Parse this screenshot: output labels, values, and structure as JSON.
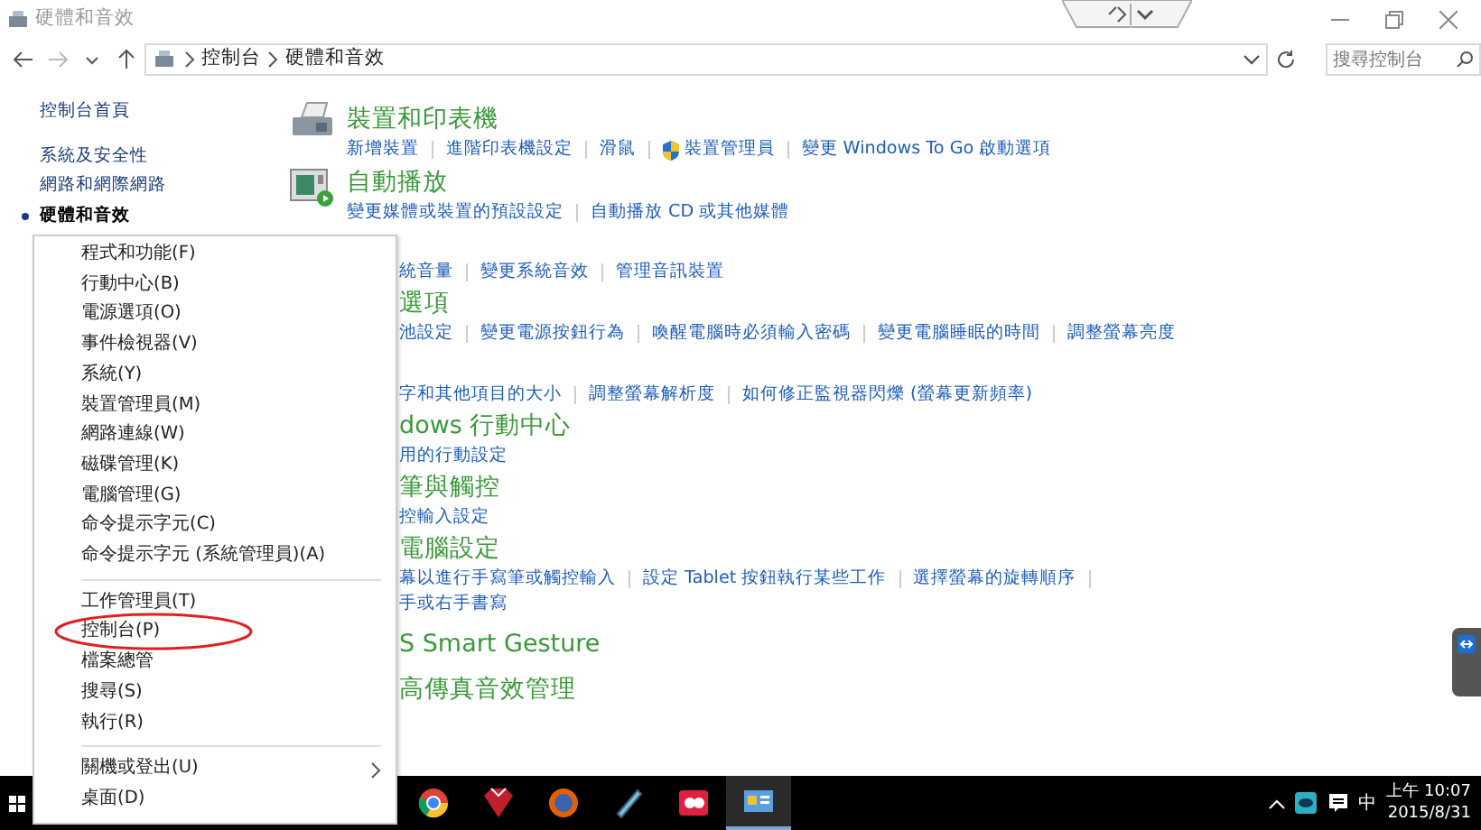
{
  "window": {
    "title": "硬體和音效"
  },
  "address_bar": {
    "breadcrumbs": [
      "控制台",
      "硬體和音效"
    ],
    "search_placeholder": "搜尋控制台"
  },
  "sidebar": {
    "items": [
      {
        "label": "控制台首頁",
        "kind": "home",
        "selected": false
      },
      {
        "label": "系統及安全性",
        "kind": "category",
        "selected": false
      },
      {
        "label": "網路和網際網路",
        "kind": "category",
        "selected": false
      },
      {
        "label": "硬體和音效",
        "kind": "category",
        "selected": true
      }
    ]
  },
  "sections": [
    {
      "title": "裝置和印表機",
      "links": [
        {
          "label": "新增裝置",
          "shield": false
        },
        {
          "label": "進階印表機設定",
          "shield": false
        },
        {
          "label": "滑鼠",
          "shield": false
        },
        {
          "label": "裝置管理員",
          "shield": true
        },
        {
          "label": "變更 Windows To Go 啟動選項",
          "shield": false
        }
      ]
    },
    {
      "title": "自動播放",
      "links": [
        {
          "label": "變更媒體或裝置的預設設定",
          "shield": false
        },
        {
          "label": "自動播放 CD 或其他媒體",
          "shield": false
        }
      ]
    }
  ],
  "sections_behind_menu": [
    {
      "link_rows": [
        {
          "links": [
            "統音量",
            "變更系統音效",
            "管理音訊裝置"
          ],
          "trailing_separator": false
        }
      ]
    },
    {
      "title": "選項",
      "link_rows": [
        {
          "links": [
            "池設定",
            "變更電源按鈕行為",
            "喚醒電腦時必須輸入密碼",
            "變更電腦睡眠的時間",
            "調整螢幕亮度"
          ],
          "trailing_separator": false
        }
      ]
    },
    {
      "link_rows": [
        {
          "links": [
            "字和其他項目的大小",
            "調整螢幕解析度",
            "如何修正監視器閃爍 (螢幕更新頻率)"
          ],
          "trailing_separator": false
        }
      ]
    },
    {
      "title": "dows 行動中心",
      "link_rows": [
        {
          "links": [
            "用的行動設定"
          ],
          "trailing_separator": false
        }
      ]
    },
    {
      "title": "筆與觸控",
      "link_rows": [
        {
          "links": [
            "控輸入設定"
          ],
          "trailing_separator": false
        }
      ]
    },
    {
      "title": "電腦設定",
      "link_rows": [
        {
          "links": [
            "幕以進行手寫筆或觸控輸入",
            "設定 Tablet 按鈕執行某些工作",
            "選擇螢幕的旋轉順序"
          ],
          "trailing_separator": true
        },
        {
          "links": [
            "手或右手書寫"
          ],
          "trailing_separator": false
        }
      ]
    },
    {
      "title": "S Smart Gesture"
    },
    {
      "title": "高傳真音效管理"
    }
  ],
  "context_menu": {
    "groups": [
      [
        {
          "label": "程式和功能(F)",
          "submenu": false,
          "circled": false
        },
        {
          "label": "行動中心(B)",
          "submenu": false,
          "circled": false
        },
        {
          "label": "電源選項(O)",
          "submenu": false,
          "circled": false
        },
        {
          "label": "事件檢視器(V)",
          "submenu": false,
          "circled": false
        },
        {
          "label": "系統(Y)",
          "submenu": false,
          "circled": false
        },
        {
          "label": "裝置管理員(M)",
          "submenu": false,
          "circled": false
        },
        {
          "label": "網路連線(W)",
          "submenu": false,
          "circled": false
        },
        {
          "label": "磁碟管理(K)",
          "submenu": false,
          "circled": false
        },
        {
          "label": "電腦管理(G)",
          "submenu": false,
          "circled": false
        },
        {
          "label": "命令提示字元(C)",
          "submenu": false,
          "circled": false
        },
        {
          "label": "命令提示字元 (系統管理員)(A)",
          "submenu": false,
          "circled": false
        }
      ],
      [
        {
          "label": "工作管理員(T)",
          "submenu": false,
          "circled": false
        },
        {
          "label": "控制台(P)",
          "submenu": false,
          "circled": true
        },
        {
          "label": "檔案總管",
          "submenu": false,
          "circled": false
        },
        {
          "label": "搜尋(S)",
          "submenu": false,
          "circled": false
        },
        {
          "label": "執行(R)",
          "submenu": false,
          "circled": false
        }
      ],
      [
        {
          "label": "關機或登出(U)",
          "submenu": true,
          "circled": false
        },
        {
          "label": "桌面(D)",
          "submenu": false,
          "circled": false
        }
      ]
    ]
  },
  "taskbar": {
    "apps": [
      {
        "active": false
      },
      {
        "active": false
      },
      {
        "active": false
      },
      {
        "active": false
      },
      {
        "active": false
      },
      {
        "active": true
      }
    ],
    "input_indicator": "中",
    "time": "上午 10:07",
    "date": "2015/8/31"
  }
}
